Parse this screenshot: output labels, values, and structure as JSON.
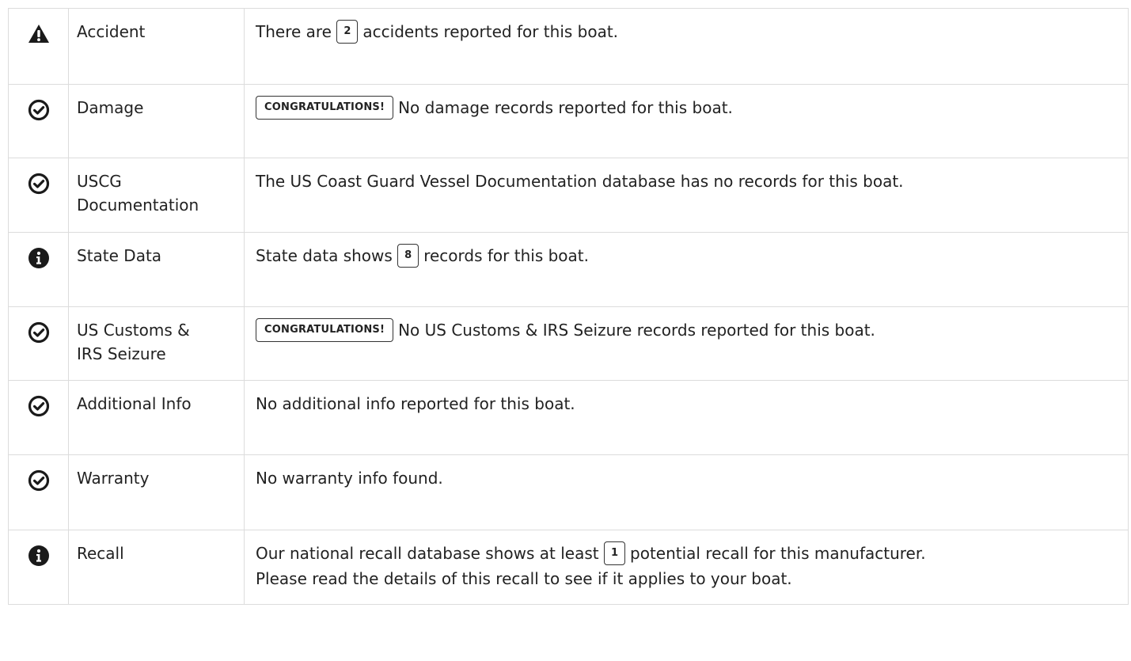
{
  "rows": [
    {
      "icon": "warning-icon",
      "label": "Accident",
      "text_before": "There are",
      "badge": "2",
      "text_after": "accidents reported for this boat."
    },
    {
      "icon": "check-circle-icon",
      "label": "Damage",
      "badge": "CONGRATULATIONS!",
      "text_after": "No damage records reported for this boat."
    },
    {
      "icon": "check-circle-icon",
      "label_line1": "USCG",
      "label_line2": "Documentation",
      "text": "The US Coast Guard Vessel Documentation database has no records for this boat."
    },
    {
      "icon": "info-circle-icon",
      "label": "State Data",
      "text_before": "State data shows",
      "badge": "8",
      "text_after": "records for this boat."
    },
    {
      "icon": "check-circle-icon",
      "label_line1": "US Customs &",
      "label_line2": "IRS Seizure",
      "badge": "CONGRATULATIONS!",
      "text_after": "No US Customs & IRS Seizure records reported for this boat."
    },
    {
      "icon": "check-circle-icon",
      "label": "Additional Info",
      "text": "No additional info reported for this boat."
    },
    {
      "icon": "check-circle-icon",
      "label": "Warranty",
      "text": "No warranty info found."
    },
    {
      "icon": "info-circle-icon",
      "label": "Recall",
      "text_before": "Our national recall database shows at least",
      "badge": "1",
      "text_after": "potential recall for this manufacturer.",
      "text_line2": "Please read the details of this recall to see if it applies to your boat."
    }
  ],
  "colors": {
    "icon": "#1a1a1a",
    "border": "#dcdcdc",
    "text": "#222222"
  }
}
